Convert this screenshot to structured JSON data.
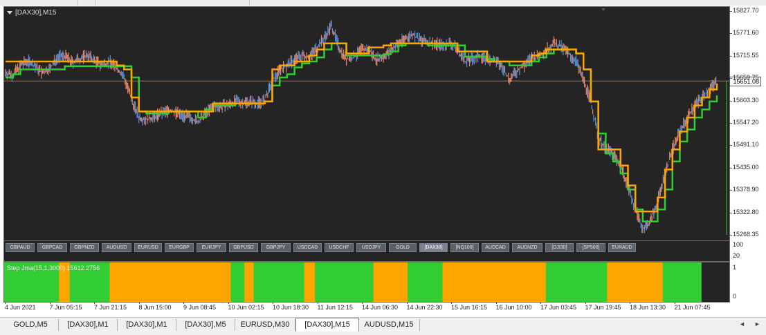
{
  "chart": {
    "title": "[DAX30],M15",
    "current_price": "15651.08",
    "price_axis": [
      "15827.70",
      "15771.60",
      "15715.55",
      "15659.75",
      "15603.30",
      "15547.20",
      "15491.10",
      "15435.00",
      "15378.90",
      "15322.80",
      "15268.35"
    ],
    "time_axis": [
      "4 Jun 2021",
      "7 Jun 05:15",
      "7 Jun 21:15",
      "8 Jun 15:00",
      "9 Jun 08:45",
      "10 Jun 02:15",
      "10 Jun 18:30",
      "11 Jun 12:15",
      "14 Jun 06:30",
      "14 Jun 22:30",
      "15 Jun 16:15",
      "16 Jun 10:00",
      "17 Jun 03:45",
      "17 Jun 19:45",
      "18 Jun 13:30",
      "21 Jun 07:45"
    ],
    "colors": {
      "background": "#242424",
      "orange_line": "#ffa500",
      "green_line": "#32cd32",
      "candles_up": "#5b8fd6",
      "candles_down": "#e8866a",
      "price_line": "#d2691e"
    },
    "series": {
      "price_path": [
        15672,
        15665,
        15690,
        15702,
        15688,
        15670,
        15682,
        15711,
        15714,
        15697,
        15706,
        15716,
        15702,
        15690,
        15700,
        15684,
        15660,
        15605,
        15560,
        15555,
        15560,
        15570,
        15578,
        15572,
        15565,
        15560,
        15548,
        15570,
        15588,
        15588,
        15590,
        15600,
        15598,
        15600,
        15596,
        15603,
        15650,
        15680,
        15690,
        15705,
        15715,
        15712,
        15735,
        15758,
        15790,
        15735,
        15705,
        15710,
        15728,
        15730,
        15706,
        15710,
        15728,
        15745,
        15758,
        15768,
        15752,
        15748,
        15745,
        15740,
        15746,
        15730,
        15700,
        15706,
        15715,
        15705,
        15700,
        15688,
        15655,
        15676,
        15690,
        15710,
        15712,
        15730,
        15745,
        15736,
        15720,
        15700,
        15655,
        15600,
        15510,
        15482,
        15470,
        15440,
        15390,
        15330,
        15282,
        15298,
        15350,
        15420,
        15480,
        15525,
        15560,
        15590,
        15610,
        15632,
        15650
      ],
      "orange_step": [
        15700,
        15700,
        15700,
        15700,
        15700,
        15700,
        15700,
        15700,
        15700,
        15700,
        15700,
        15700,
        15700,
        15700,
        15700,
        15690,
        15680,
        15610,
        15575,
        15575,
        15575,
        15575,
        15575,
        15575,
        15575,
        15575,
        15575,
        15575,
        15595,
        15595,
        15595,
        15595,
        15595,
        15595,
        15595,
        15600,
        15680,
        15690,
        15690,
        15700,
        15700,
        15715,
        15730,
        15745,
        15745,
        15745,
        15720,
        15720,
        15720,
        15735,
        15735,
        15740,
        15745,
        15745,
        15745,
        15745,
        15745,
        15745,
        15745,
        15745,
        15745,
        15725,
        15725,
        15725,
        15725,
        15700,
        15700,
        15700,
        15700,
        15700,
        15700,
        15715,
        15720,
        15730,
        15730,
        15730,
        15730,
        15720,
        15680,
        15600,
        15480,
        15480,
        15480,
        15440,
        15390,
        15325,
        15325,
        15325,
        15360,
        15430,
        15480,
        15525,
        15560,
        15590,
        15610,
        15630,
        15645
      ],
      "green_step": [
        15660,
        15668,
        15680,
        15680,
        15680,
        15680,
        15680,
        15680,
        15688,
        15688,
        15688,
        15688,
        15688,
        15688,
        15688,
        15688,
        15688,
        15660,
        15575,
        15570,
        15570,
        15570,
        15575,
        15575,
        15575,
        15575,
        15560,
        15580,
        15590,
        15590,
        15590,
        15595,
        15595,
        15595,
        15595,
        15600,
        15640,
        15660,
        15668,
        15685,
        15695,
        15700,
        15710,
        15730,
        15745,
        15745,
        15715,
        15715,
        15715,
        15715,
        15715,
        15718,
        15725,
        15740,
        15745,
        15745,
        15745,
        15740,
        15740,
        15740,
        15740,
        15740,
        15712,
        15712,
        15712,
        15706,
        15700,
        15700,
        15690,
        15690,
        15690,
        15700,
        15710,
        15720,
        15730,
        15730,
        15730,
        15720,
        15680,
        15600,
        15520,
        15470,
        15450,
        15420,
        15380,
        15330,
        15300,
        15300,
        15330,
        15380,
        15450,
        15500,
        15530,
        15560,
        15580,
        15600,
        15615
      ]
    }
  },
  "symbol_buttons": [
    "GBPAUD",
    "GBPCAD",
    "GBPNZD",
    "AUDUSD",
    "EURUSD",
    "EURGBP",
    "EURJPY",
    "GBPUSD",
    "GBPJPY",
    "USDCAD",
    "USDCHF",
    "USDJPY",
    "GOLD",
    "[DAX30]",
    "[NQ100]",
    "AUDCAD",
    "AUDNZD",
    "[DJI30]",
    "[SP500]",
    "EURAUD"
  ],
  "active_symbol": "[DAX30]",
  "buttons_axis": [
    "100",
    "20"
  ],
  "indicator": {
    "title": "Step Jma(15,1,3000) 15612.2756",
    "axis": [
      "1",
      "0"
    ],
    "segments": [
      {
        "color": "#32cd32",
        "start": 0,
        "end": 0.077
      },
      {
        "color": "#ffa500",
        "start": 0.077,
        "end": 0.092
      },
      {
        "color": "#32cd32",
        "start": 0.092,
        "end": 0.148
      },
      {
        "color": "#ffa500",
        "start": 0.148,
        "end": 0.318
      },
      {
        "color": "#32cd32",
        "start": 0.318,
        "end": 0.337
      },
      {
        "color": "#ffa500",
        "start": 0.337,
        "end": 0.35
      },
      {
        "color": "#32cd32",
        "start": 0.35,
        "end": 0.421
      },
      {
        "color": "#ffa500",
        "start": 0.421,
        "end": 0.436
      },
      {
        "color": "#32cd32",
        "start": 0.436,
        "end": 0.518
      },
      {
        "color": "#ffa500",
        "start": 0.518,
        "end": 0.566
      },
      {
        "color": "#32cd32",
        "start": 0.566,
        "end": 0.615
      },
      {
        "color": "#ffa500",
        "start": 0.615,
        "end": 0.76
      },
      {
        "color": "#32cd32",
        "start": 0.76,
        "end": 0.846
      },
      {
        "color": "#ffa500",
        "start": 0.846,
        "end": 0.924
      },
      {
        "color": "#32cd32",
        "start": 0.924,
        "end": 0.978
      }
    ]
  },
  "tabs": [
    "GOLD,M5",
    "[DAX30],M1",
    "[DAX30],M1",
    "[DAX30],M5",
    "EURUSD,M30",
    "[DAX30],M15",
    "AUDUSD,M15"
  ],
  "active_tab": "[DAX30],M15",
  "scroll_icons": [
    "scroll-left-icon",
    "scroll-right-icon"
  ]
}
